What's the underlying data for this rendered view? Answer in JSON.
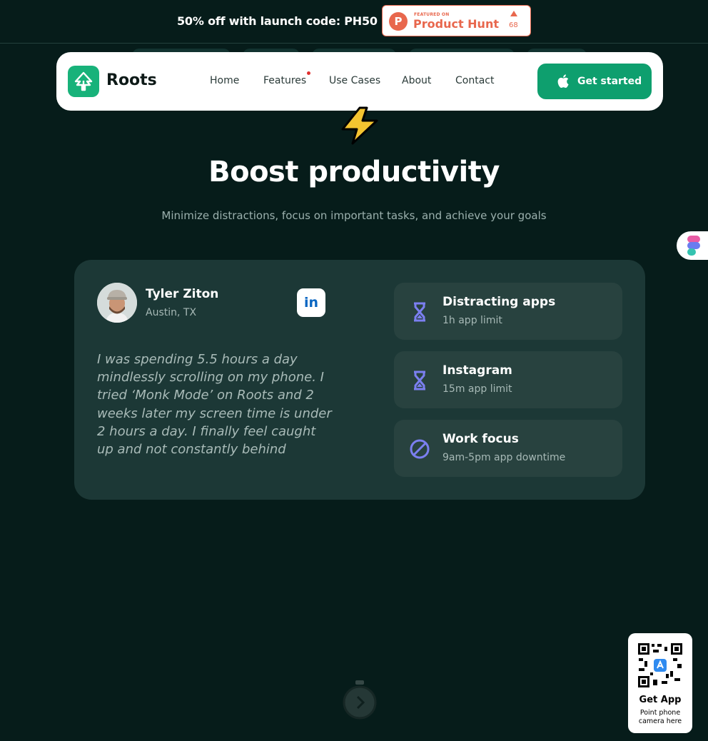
{
  "promo": {
    "text": "50% off with launch code: PH50",
    "badge": {
      "small_label": "FEATURED ON",
      "name": "Product Hunt",
      "count": "68",
      "logo_letter": "P"
    }
  },
  "nav": {
    "brand": "Roots",
    "links": [
      "Home",
      "Features",
      "Use Cases",
      "About",
      "Contact"
    ],
    "cta": "Get started"
  },
  "hero": {
    "title": "Boost productivity",
    "subtitle": "Minimize distractions, focus on important tasks, and achieve your goals"
  },
  "testimonial": {
    "name": "Tyler Ziton",
    "location": "Austin, TX",
    "linkedin_label": "in",
    "quote": "I was spending 5.5 hours a day mindlessly scrolling on my phone. I tried ‘Monk Mode’ on Roots and 2 weeks later my screen time is under 2 hours a day. I finally feel caught up and not constantly behind"
  },
  "features": [
    {
      "icon": "hourglass-icon",
      "title": "Distracting apps",
      "subtitle": "1h app limit"
    },
    {
      "icon": "hourglass-icon",
      "title": "Instagram",
      "subtitle": "15m app limit"
    },
    {
      "icon": "block-icon",
      "title": "Work focus",
      "subtitle": "9am-5pm app downtime"
    }
  ],
  "qr": {
    "title": "Get App",
    "subtitle": "Point phone camera here"
  },
  "colors": {
    "background": "#061c1a",
    "brand": "#18b27a",
    "cta": "#0e9f6e",
    "card": "#1c3836",
    "accent_icon": "#7b7ff0"
  }
}
